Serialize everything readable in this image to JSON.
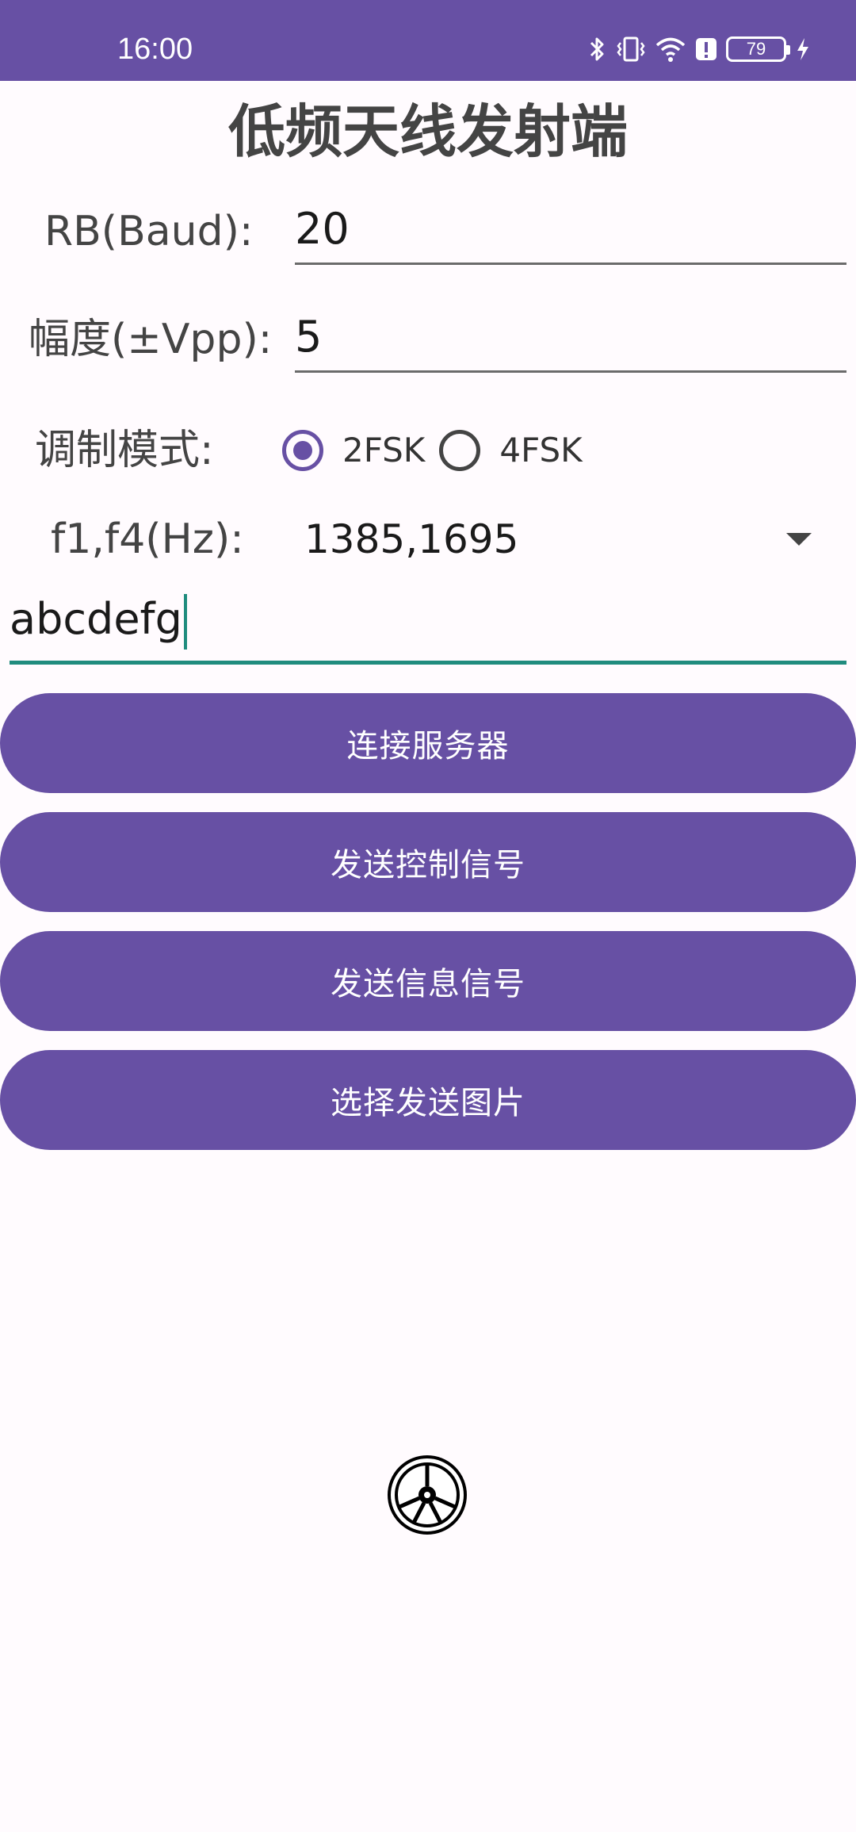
{
  "status_bar": {
    "time": "16:00",
    "battery": "79",
    "icons": [
      "bluetooth-icon",
      "vibrate-icon",
      "wifi-icon",
      "alert-icon",
      "battery-icon",
      "charging-icon"
    ],
    "background": "#6750a4"
  },
  "title": "低频天线发射端",
  "form": {
    "rb_label": "RB(Baud):",
    "rb_value": "20",
    "amp_label": "幅度(±Vpp):",
    "amp_value": "5",
    "mod_label": "调制模式:",
    "mod_options": [
      "2FSK",
      "4FSK"
    ],
    "mod_selected": "2FSK",
    "freq_label": "f1,f4(Hz):",
    "freq_value": "1385,1695",
    "message_value": "abcdefg"
  },
  "buttons": {
    "connect": "连接服务器",
    "send_control": "发送控制信号",
    "send_info": "发送信息信号",
    "select_image": "选择发送图片"
  },
  "colors": {
    "accent": "#6750a4",
    "input_focus": "#208c7e"
  },
  "center_icon": "wheel-icon"
}
